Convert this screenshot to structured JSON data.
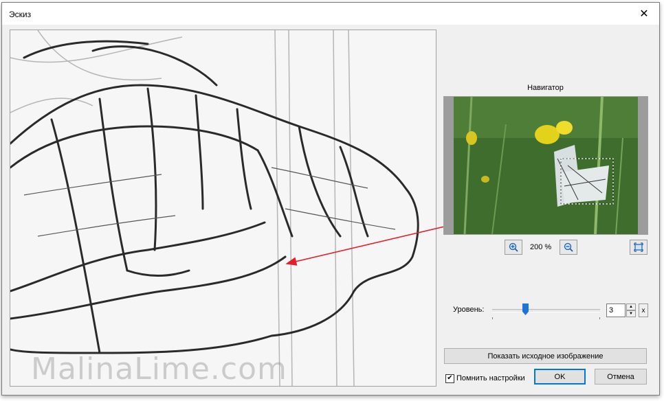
{
  "window": {
    "title": "Эскиз",
    "close_glyph": "✕"
  },
  "watermark": "MalinaLime.com",
  "navigator": {
    "title": "Навигатор",
    "zoom_label": "200 %",
    "zoom_in_icon": "zoom-in-icon",
    "zoom_out_icon": "zoom-out-icon",
    "fit_icon": "fit-to-window-icon"
  },
  "level": {
    "label": "Уровень:",
    "value": "3",
    "slider_fraction": 0.3,
    "reset_label": "x"
  },
  "buttons": {
    "show_original": "Показать исходное изображение",
    "ok": "OK",
    "cancel": "Отмена"
  },
  "remember": {
    "label": "Помнить настройки",
    "checked": true
  },
  "colors": {
    "accent": "#0078d7",
    "slider_thumb": "#1e74d6",
    "arrow": "#e0202a"
  }
}
